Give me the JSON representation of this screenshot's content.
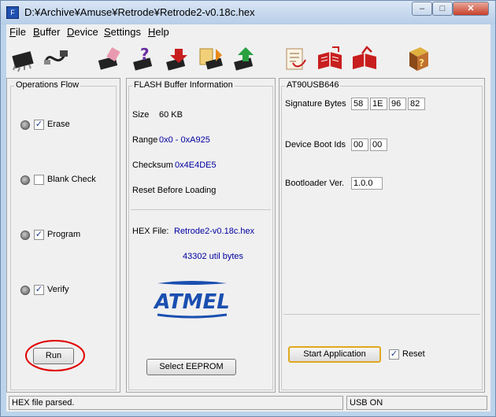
{
  "window": {
    "title": "D:¥Archive¥Amuse¥Retrode¥Retrode2-v0.18c.hex",
    "app_icon": "flip-icon"
  },
  "menu": [
    {
      "mnemonic": "F",
      "rest": "ile"
    },
    {
      "mnemonic": "B",
      "rest": "uffer"
    },
    {
      "mnemonic": "D",
      "rest": "evice"
    },
    {
      "mnemonic": "S",
      "rest": "ettings"
    },
    {
      "mnemonic": "H",
      "rest": "elp"
    }
  ],
  "toolbar": [
    "select-device-icon",
    "usb-communication-icon",
    "erase-icon",
    "blank-check-icon",
    "program-icon",
    "read-icon",
    "verify-icon",
    "load-hex-icon",
    "save-hex-icon",
    "edit-buffer-icon",
    "help-book-icon"
  ],
  "operations": {
    "legend": "Operations Flow",
    "steps": [
      {
        "label": "Erase",
        "checked": "✓"
      },
      {
        "label": "Blank Check",
        "checked": ""
      },
      {
        "label": "Program",
        "checked": "✓"
      },
      {
        "label": "Verify",
        "checked": "✓"
      }
    ],
    "run_label": "Run"
  },
  "flash": {
    "legend": "FLASH Buffer Information",
    "size_label": "Size",
    "size_value": "60 KB",
    "range_label": "Range",
    "range_value": "0x0 - 0xA925",
    "checksum_label": "Checksum",
    "checksum_value": "0x4E4DE5",
    "reset_before_loading": "Reset Before Loading",
    "hex_file_label": "HEX File:",
    "hex_file_value": "Retrode2-v0.18c.hex",
    "bytes_value": "43302 util bytes",
    "logo_text": "ATMEL",
    "eeprom_label": "Select EEPROM"
  },
  "device": {
    "legend": "AT90USB646",
    "signature_label": "Signature Bytes",
    "signature": [
      "58",
      "1E",
      "96",
      "82"
    ],
    "boot_ids_label": "Device Boot Ids",
    "boot_ids": [
      "00",
      "00"
    ],
    "bootloader_label": "Bootloader Ver.",
    "bootloader_value": "1.0.0",
    "start_app_label": "Start Application",
    "reset_label": "Reset",
    "reset_checked": "✓"
  },
  "status": {
    "message": "HEX file parsed.",
    "connection": "USB ON"
  },
  "colors": {
    "value_text": "#0000a0",
    "annotation_circle": "#e00000",
    "start_app_border": "#e0a820"
  }
}
